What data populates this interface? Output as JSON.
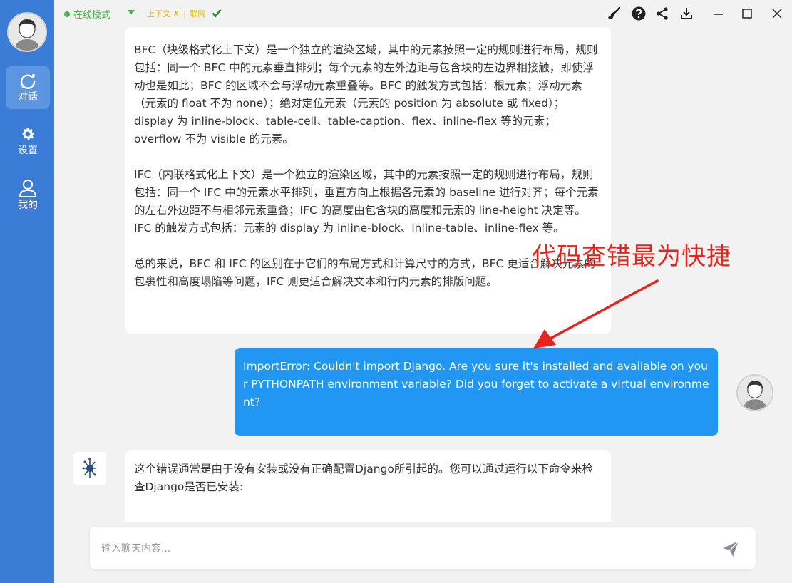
{
  "sidebar": {
    "items": [
      {
        "label": "对话",
        "icon": "chat-icon",
        "active": true
      },
      {
        "label": "设置",
        "icon": "gear-icon",
        "active": false
      },
      {
        "label": "我的",
        "icon": "user-icon",
        "active": false
      }
    ]
  },
  "topbar": {
    "mode_label": "在线模式",
    "context_label": "上下文",
    "context_status": "✗",
    "separator": "|",
    "network_label": "联网",
    "icons": [
      "broom-icon",
      "help-icon",
      "share-icon",
      "download-icon",
      "minimize-icon",
      "maximize-icon",
      "close-icon"
    ]
  },
  "messages": {
    "ai1": {
      "p1": "BFC（块级格式化上下文）是一个独立的渲染区域，其中的元素按照一定的规则进行布局，规则包括：同一个 BFC 中的元素垂直排列；每个元素的左外边距与包含块的左边界相接触，即使浮动也是如此；BFC 的区域不会与浮动元素重叠等。BFC 的触发方式包括：根元素；浮动元素（元素的 float 不为 none）；绝对定位元素（元素的 position 为 absolute 或 fixed）；display 为 inline-block、table-cell、table-caption、flex、inline-flex 等的元素；overflow 不为 visible 的元素。",
      "p2": "IFC（内联格式化上下文）是一个独立的渲染区域，其中的元素按照一定的规则进行布局，规则包括：同一个 IFC 中的元素水平排列，垂直方向上根据各元素的 baseline 进行对齐；每个元素的左右外边距不与相邻元素重叠；IFC 的高度由包含块的高度和元素的 line-height 决定等。IFC 的触发方式包括：元素的 display 为 inline-block、inline-table、inline-flex 等。",
      "p3": "总的来说，BFC 和 IFC 的区别在于它们的布局方式和计算尺寸的方式，BFC 更适合解决元素的包裹性和高度塌陷等问题，IFC 则更适合解决文本和行内元素的排版问题。"
    },
    "user": {
      "text": "ImportError: Couldn't import Django. Are you sure it's installed and available on your PYTHONPATH environment variable? Did you forget to activate a virtual environment?"
    },
    "ai2": {
      "text": "这个错误通常是由于没有安装或没有正确配置Django所引起的。您可以通过运行以下命令来检查Django是否已安装:"
    }
  },
  "annotation": {
    "text": "代码查错最为快捷",
    "color": "#e8231c"
  },
  "input": {
    "placeholder": "输入聊天内容..."
  },
  "colors": {
    "sidebar": "#3b7cd6",
    "user_bubble": "#2196f3",
    "online": "#4cae4c",
    "context": "#e6b800"
  }
}
